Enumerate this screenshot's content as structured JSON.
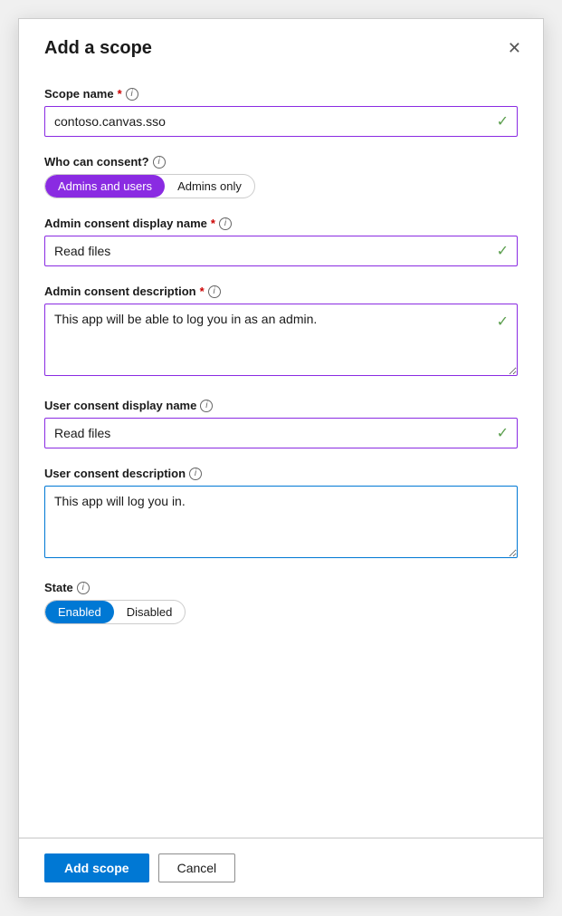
{
  "dialog": {
    "title": "Add a scope",
    "close_label": "✕"
  },
  "fields": {
    "scope_name": {
      "label": "Scope name",
      "required": true,
      "value": "contoso.canvas.sso",
      "placeholder": ""
    },
    "who_can_consent": {
      "label": "Who can consent?",
      "options": [
        "Admins and users",
        "Admins only"
      ],
      "selected": "Admins and users"
    },
    "admin_consent_display_name": {
      "label": "Admin consent display name",
      "required": true,
      "value": "Read files",
      "placeholder": ""
    },
    "admin_consent_description": {
      "label": "Admin consent description",
      "required": true,
      "value": "This app will be able to log you in as an admin.",
      "placeholder": ""
    },
    "user_consent_display_name": {
      "label": "User consent display name",
      "required": false,
      "value": "Read files",
      "placeholder": ""
    },
    "user_consent_description": {
      "label": "User consent description",
      "required": false,
      "value": "This app will log you in.",
      "placeholder": ""
    },
    "state": {
      "label": "State",
      "options": [
        "Enabled",
        "Disabled"
      ],
      "selected": "Enabled"
    }
  },
  "footer": {
    "add_scope": "Add scope",
    "cancel": "Cancel"
  },
  "icons": {
    "info": "i",
    "checkmark": "✓",
    "close": "✕"
  }
}
